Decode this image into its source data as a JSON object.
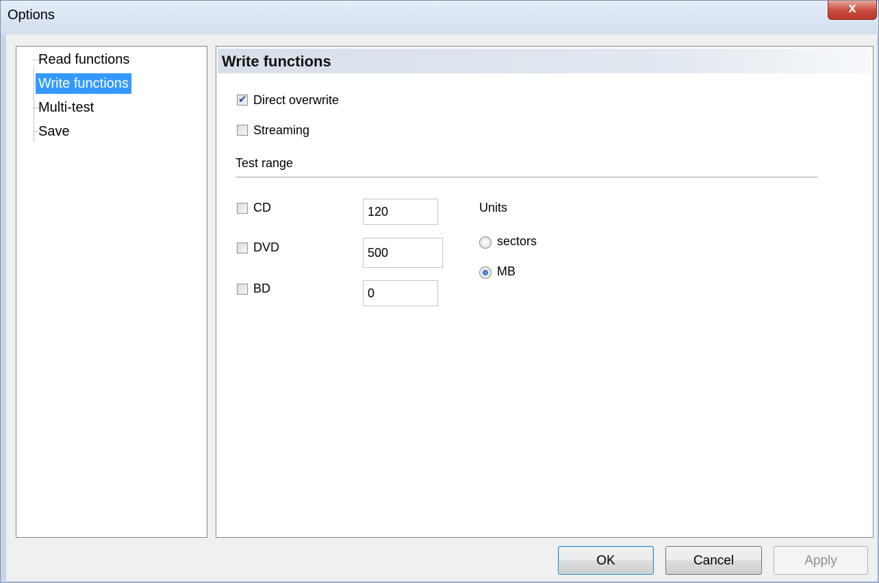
{
  "window": {
    "title": "Options",
    "close_label": "x"
  },
  "tree": {
    "items": [
      {
        "label": "Read functions",
        "selected": false
      },
      {
        "label": "Write functions",
        "selected": true
      },
      {
        "label": "Multi-test",
        "selected": false
      },
      {
        "label": "Save",
        "selected": false
      }
    ]
  },
  "panel": {
    "header": "Write functions",
    "direct_overwrite": {
      "label": "Direct overwrite",
      "checked": true
    },
    "streaming": {
      "label": "Streaming",
      "checked": false
    },
    "test_range": {
      "title": "Test range",
      "cd": {
        "label": "CD",
        "checked": false,
        "value": "120"
      },
      "dvd": {
        "label": "DVD",
        "checked": false,
        "value": "500"
      },
      "bd": {
        "label": "BD",
        "checked": false,
        "value": "0"
      }
    },
    "units": {
      "title": "Units",
      "sectors": {
        "label": "sectors",
        "selected": false
      },
      "mb": {
        "label": "MB",
        "selected": true
      }
    }
  },
  "buttons": {
    "ok": "OK",
    "cancel": "Cancel",
    "apply": "Apply"
  }
}
